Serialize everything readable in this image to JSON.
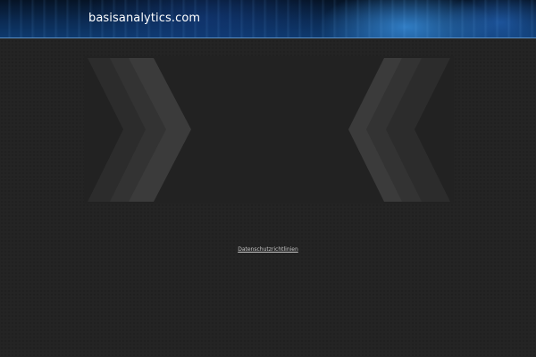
{
  "header": {
    "site_title": "basisanalytics.com"
  },
  "footer": {
    "privacy_link": "Datenschutzrichtlinien"
  },
  "colors": {
    "background": "#242424",
    "header_blue": "#0e3a6e",
    "header_line": "#5a8fc4",
    "chevron_dark": "#2e2e2e",
    "chevron_mid": "#353535",
    "chevron_light": "#3c3c3c"
  }
}
